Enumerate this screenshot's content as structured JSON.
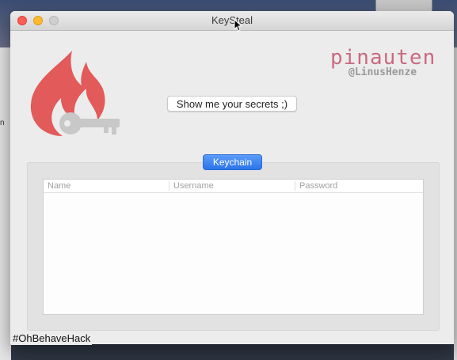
{
  "window": {
    "title": "KeySteal"
  },
  "desktop": {
    "left_edge_text": "n"
  },
  "brand": {
    "name": "pinauten",
    "handle": "@LinusHenze"
  },
  "buttons": {
    "secrets_label": "Show me your secrets ;)",
    "keychain_label": "Keychain"
  },
  "table": {
    "columns": [
      "Name",
      "Username",
      "Password"
    ],
    "rows": []
  },
  "overlay": {
    "hashtag": "#OhBehaveHack"
  },
  "colors": {
    "flame": "#e25a5a",
    "key": "#c8c8c8",
    "brand_pink": "#c96a80",
    "accent_blue": "#2a74ea"
  },
  "icons": [
    "flame-key-logo",
    "mouse-cursor"
  ]
}
